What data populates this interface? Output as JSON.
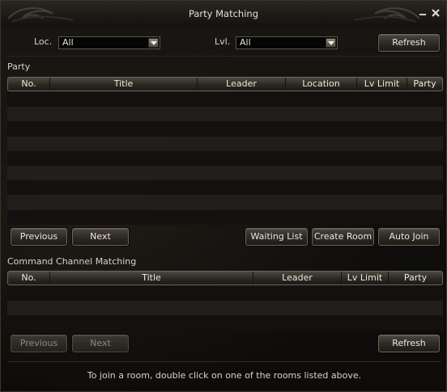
{
  "window": {
    "title": "Party Matching"
  },
  "filters": {
    "loc_label": "Loc.",
    "loc_value": "All",
    "lvl_label": "Lvl.",
    "lvl_value": "All",
    "refresh_label": "Refresh"
  },
  "party": {
    "section_label": "Party",
    "columns": [
      "No.",
      "Title",
      "Leader",
      "Location",
      "Lv Limit",
      "Party"
    ],
    "rows": [],
    "buttons": {
      "previous": "Previous",
      "next": "Next",
      "waiting_list": "Waiting List",
      "create_room": "Create Room",
      "auto_join": "Auto Join"
    }
  },
  "command_channel": {
    "section_label": "Command Channel Matching",
    "columns": [
      "No.",
      "Title",
      "Leader",
      "Lv Limit",
      "Party"
    ],
    "rows": [],
    "buttons": {
      "previous": "Previous",
      "next": "Next",
      "refresh": "Refresh"
    }
  },
  "footer": {
    "hint": "To join a room, double click on one of the rooms listed above."
  },
  "icons": {
    "minimize": "minimize-icon",
    "close": "close-icon",
    "dropdown": "chevron-down-icon"
  }
}
